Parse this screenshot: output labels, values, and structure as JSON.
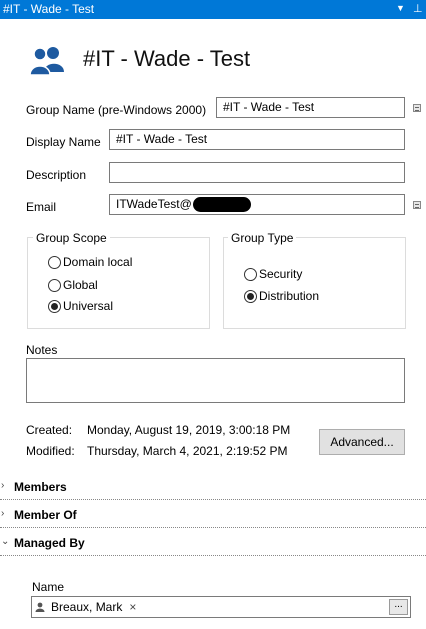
{
  "panel": {
    "title": "#IT - Wade - Test",
    "dropdown_icon": "chevron-down-icon",
    "pin_icon": "pin-icon"
  },
  "header": {
    "icon": "group-users-icon",
    "title": "#IT - Wade - Test"
  },
  "form": {
    "pre_windows_label": "Group Name (pre-Windows 2000)",
    "pre_windows_value": "#IT - Wade - Test",
    "display_name_label": "Display Name",
    "display_name_value": "#IT - Wade - Test",
    "description_label": "Description",
    "description_value": "",
    "email_label": "Email",
    "email_value": "ITWadeTest@"
  },
  "group_scope": {
    "title": "Group Scope",
    "options": [
      {
        "label": "Domain local",
        "selected": false
      },
      {
        "label": "Global",
        "selected": false
      },
      {
        "label": "Universal",
        "selected": true
      }
    ]
  },
  "group_type": {
    "title": "Group Type",
    "options": [
      {
        "label": "Security",
        "selected": false
      },
      {
        "label": "Distribution",
        "selected": true
      }
    ]
  },
  "notes": {
    "label": "Notes",
    "value": ""
  },
  "meta": {
    "created_label": "Created:",
    "created_value": "Monday, August 19, 2019, 3:00:18 PM",
    "modified_label": "Modified:",
    "modified_value": "Thursday, March 4, 2021, 2:19:52 PM"
  },
  "advanced_button": "Advanced...",
  "sections": [
    {
      "label": "Members",
      "expanded": false
    },
    {
      "label": "Member Of",
      "expanded": false
    },
    {
      "label": "Managed By",
      "expanded": true
    }
  ],
  "managed_by": {
    "name_label": "Name",
    "manager": "Breaux, Mark",
    "remove_glyph": "×",
    "browse_label": "..."
  },
  "colors": {
    "titlebar": "#0078d7",
    "icon_blue": "#1e5aa0"
  }
}
